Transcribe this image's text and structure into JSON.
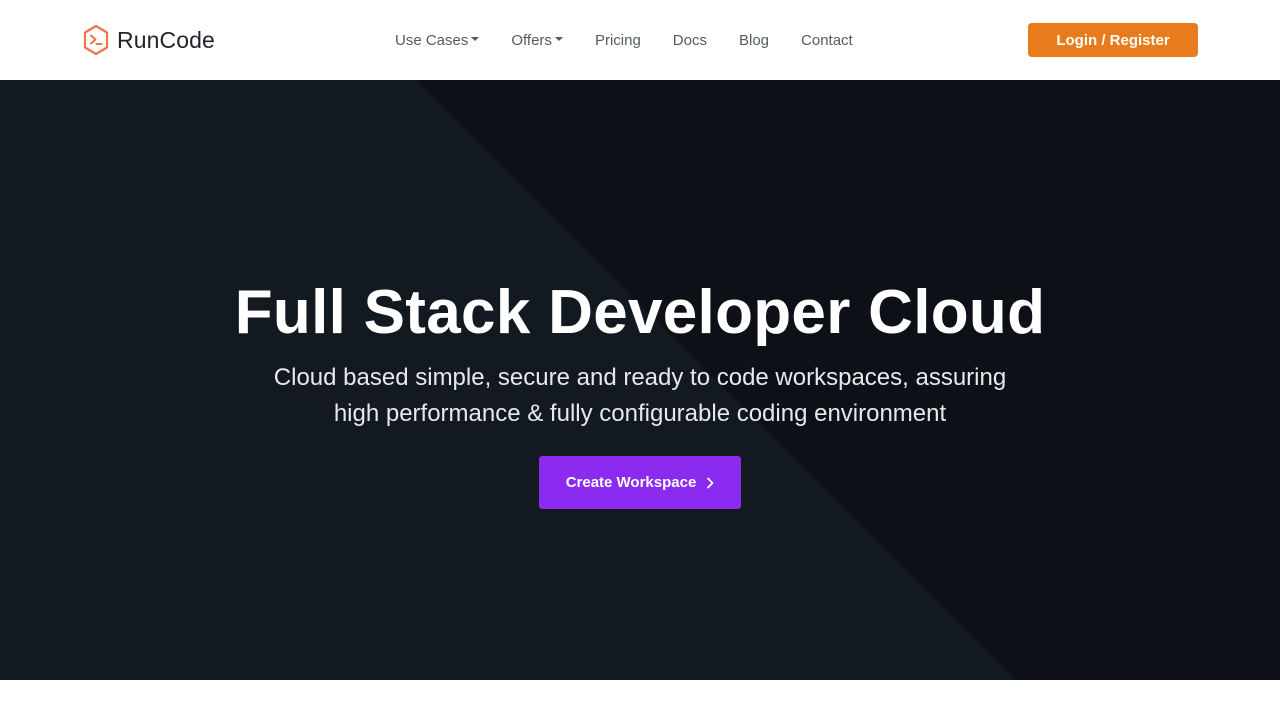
{
  "brand": {
    "name": "RunCode",
    "logo_icon": "terminal-hexagon-icon",
    "logo_color": "#e8764a"
  },
  "nav": {
    "items": [
      {
        "label": "Use Cases",
        "dropdown": true
      },
      {
        "label": "Offers",
        "dropdown": true
      },
      {
        "label": "Pricing",
        "dropdown": false
      },
      {
        "label": "Docs",
        "dropdown": false
      },
      {
        "label": "Blog",
        "dropdown": false
      },
      {
        "label": "Contact",
        "dropdown": false
      }
    ],
    "login_label": "Login / Register"
  },
  "hero": {
    "title": "Full Stack Developer Cloud",
    "subtitle_line1": "Cloud based simple, secure and ready to code workspaces, assuring",
    "subtitle_line2": "high performance & fully configurable coding environment",
    "cta_label": "Create Workspace",
    "cta_icon": "chevron-right-icon"
  },
  "colors": {
    "accent_orange": "#e87b1c",
    "accent_purple": "#8b2bf0",
    "hero_background": "#0d1117"
  }
}
